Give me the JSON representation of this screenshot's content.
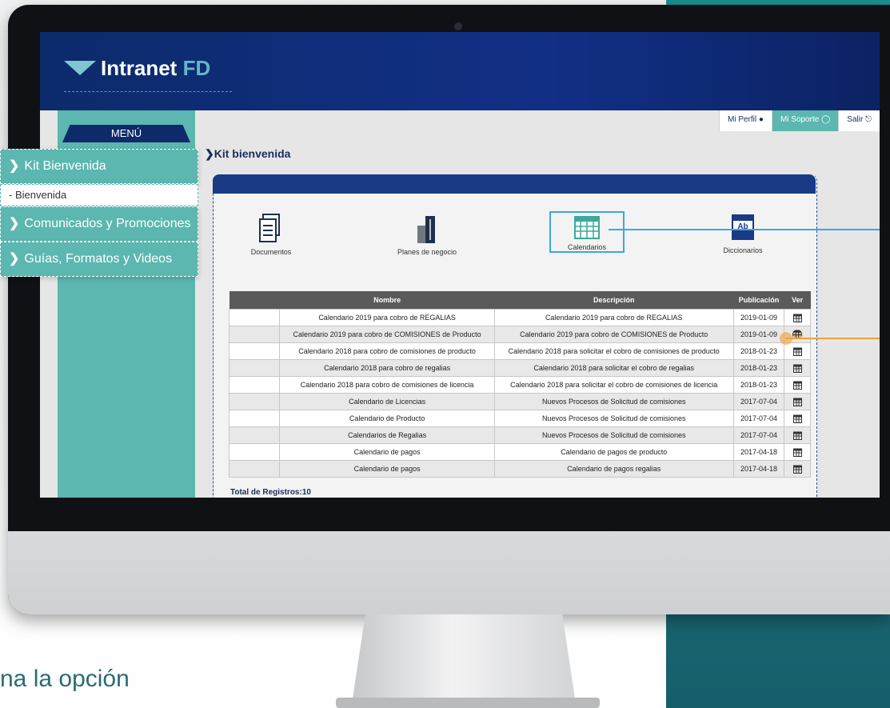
{
  "colors": {
    "header_bg": "#122f86",
    "teal": "#5bb7b0",
    "panel_head": "#1a3a85",
    "callout_blue": "#3ba7e0",
    "callout_orange": "#f0a03a"
  },
  "header": {
    "logo_text": "Intranet",
    "logo_accent": "FD"
  },
  "topnav": [
    {
      "label": "Mi Perfil",
      "icon": "user-icon"
    },
    {
      "label": "Mi Soporte",
      "icon": "headset-icon"
    },
    {
      "label": "Salir",
      "icon": "logout-icon"
    }
  ],
  "menu": {
    "title": "MENÚ",
    "items": [
      {
        "label": "Kit Bienvenida"
      },
      {
        "label": "- Bienvenida"
      },
      {
        "label": "Comunicados y Promociones"
      },
      {
        "label": "Guías, Formatos y Videos"
      }
    ]
  },
  "breadcrumb": "Kit bienvenida",
  "categories": [
    {
      "label": "Documentos",
      "icon": "documents-icon"
    },
    {
      "label": "Planes de negocio",
      "icon": "buildings-icon"
    },
    {
      "label": "Calendarios",
      "icon": "calendar-icon"
    },
    {
      "label": "Diccionarios",
      "icon": "dictionary-icon"
    }
  ],
  "table": {
    "headers": [
      "Nombre",
      "Descripción",
      "Publicación",
      "Ver"
    ],
    "rows": [
      {
        "nombre": "Calendario 2019 para cobro de REGALIAS",
        "descripcion": "Calendario 2019 para cobro de REGALIAS",
        "fecha": "2019-01-09"
      },
      {
        "nombre": "Calendario 2019 para cobro de COMISIONES de Producto",
        "descripcion": "Calendario 2019 para cobro de COMISIONES de Producto",
        "fecha": "2019-01-09"
      },
      {
        "nombre": "Calendario 2018 para cobro de comisiones de producto",
        "descripcion": "Calendario 2018 para solicitar el cobro de comisiones de producto",
        "fecha": "2018-01-23"
      },
      {
        "nombre": "Calendario 2018 para cobro de regalias",
        "descripcion": "Calendario 2018 para solicitar el cobro de regalias",
        "fecha": "2018-01-23"
      },
      {
        "nombre": "Calendario 2018 para cobro de comisiones de licencia",
        "descripcion": "Calendario 2018 para solicitar el cobro de comisiones de licencia",
        "fecha": "2018-01-23"
      },
      {
        "nombre": "Calendario de Licencias",
        "descripcion": "Nuevos Procesos de Solicitud de comisiones",
        "fecha": "2017-07-04"
      },
      {
        "nombre": "Calendario de Producto",
        "descripcion": "Nuevos Procesos de Solicitud de comisiones",
        "fecha": "2017-07-04"
      },
      {
        "nombre": "Calendarios de Regalias",
        "descripcion": "Nuevos Procesos de Solicitud de comisiones",
        "fecha": "2017-07-04"
      },
      {
        "nombre": "Calendario de pagos",
        "descripcion": "Calendario de pagos de producto",
        "fecha": "2017-04-18"
      },
      {
        "nombre": "Calendario de pagos",
        "descripcion": "Calendario de pagos regalias",
        "fecha": "2017-04-18"
      }
    ]
  },
  "total_label": "Total de Registros:10",
  "caption": "na la opción"
}
